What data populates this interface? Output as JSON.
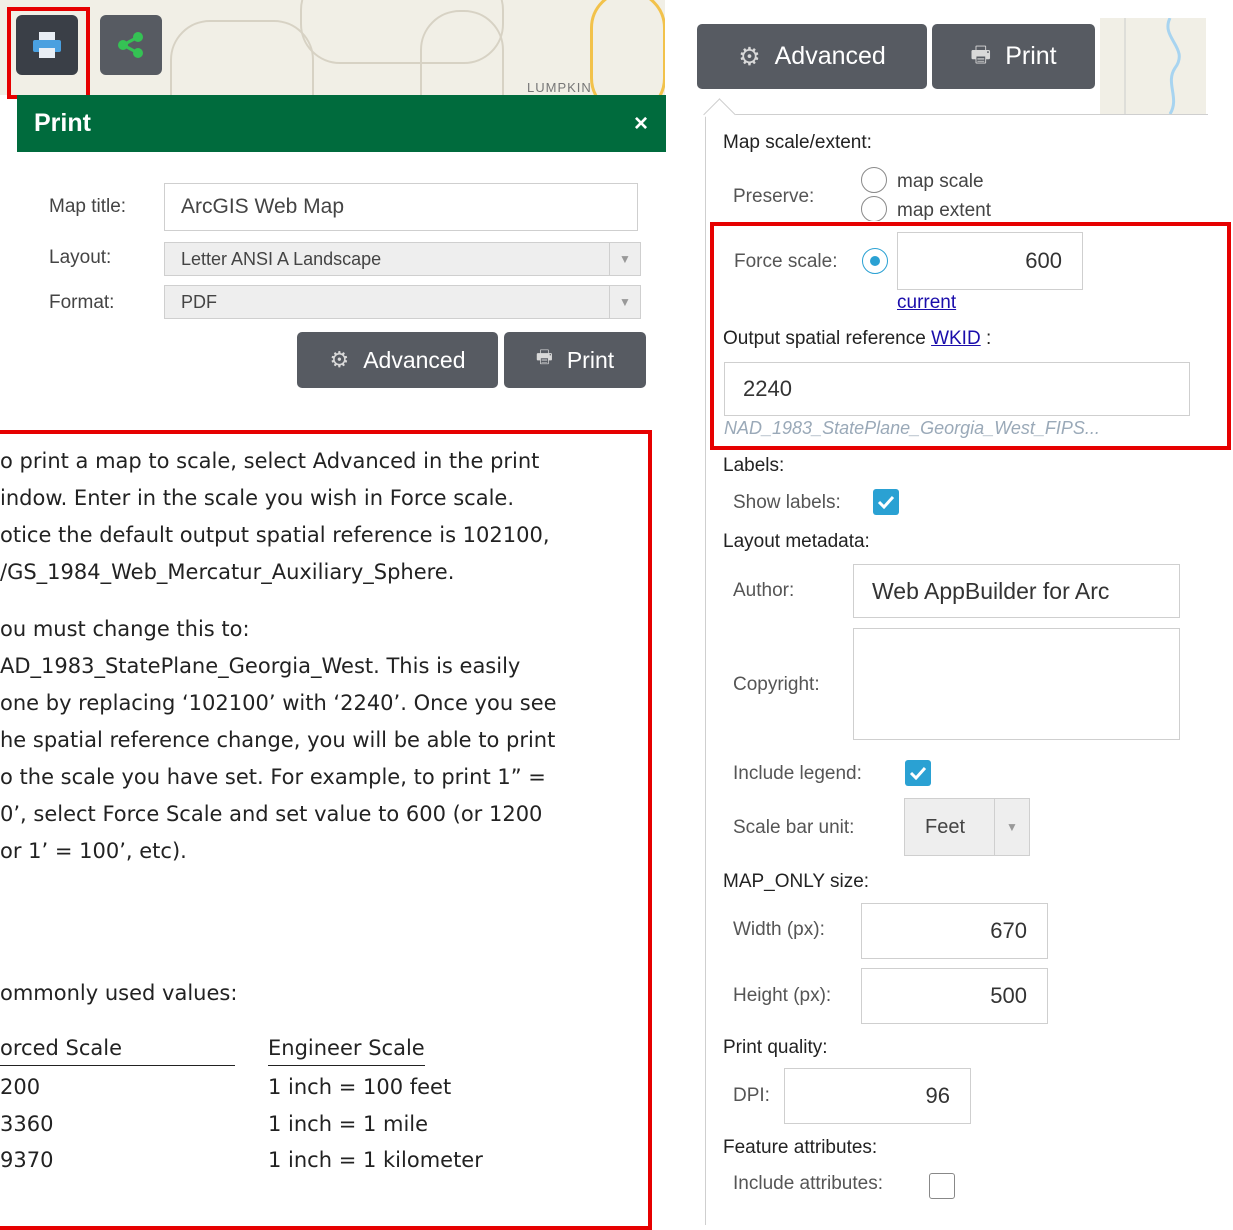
{
  "left": {
    "map_label": "LUMPKIN",
    "panel": {
      "title": "Print",
      "close": "×",
      "map_title_label": "Map title:",
      "map_title_value": "ArcGIS Web Map",
      "layout_label": "Layout:",
      "layout_value": "Letter ANSI A Landscape",
      "format_label": "Format:",
      "format_value": "PDF",
      "advanced_label": "Advanced",
      "print_label": "Print"
    },
    "note": {
      "lines": [
        "o print a map to scale, select Advanced in the print",
        "indow. Enter in the scale you wish in Force scale.",
        "otice the default output spatial reference is 102100,",
        "/GS_1984_Web_Mercatur_Auxiliary_Sphere.",
        "",
        "ou must change this to:",
        "AD_1983_StatePlane_Georgia_West. This is easily",
        "one by replacing ‘102100’ with ‘2240’. Once you see",
        "he spatial reference change, you will be able to print",
        "o the scale you have set. For example, to print 1” =",
        "0’, select Force Scale and set value to 600 (or 1200",
        "or 1’ = 100’, etc)."
      ],
      "commonly_used": "ommonly used values:",
      "col1_header": "orced Scale",
      "col2_header": "Engineer Scale",
      "rows": [
        {
          "forced": "200",
          "engineer": "1 inch = 100 feet"
        },
        {
          "forced": "3360",
          "engineer": "1 inch = 1 mile"
        },
        {
          "forced": "9370",
          "engineer": "1 inch = 1 kilometer"
        }
      ]
    }
  },
  "right": {
    "advanced_label": "Advanced",
    "print_label": "Print",
    "map_scale_extent": "Map scale/extent:",
    "preserve_label": "Preserve:",
    "opt_map_scale": "map scale",
    "opt_map_extent": "map extent",
    "force_scale_label": "Force scale:",
    "force_scale_value": "600",
    "current_link": "current",
    "osr_label": "Output spatial reference",
    "wkid_link": "WKID",
    "osr_colon": ":",
    "wkid_value": "2240",
    "wkid_name": "NAD_1983_StatePlane_Georgia_West_FIPS...",
    "labels_heading": "Labels:",
    "show_labels": "Show labels:",
    "layout_metadata": "Layout metadata:",
    "author_label": "Author:",
    "author_value": "Web AppBuilder for Arc",
    "copyright_label": "Copyright:",
    "include_legend": "Include legend:",
    "scale_bar_unit_label": "Scale bar unit:",
    "scale_bar_unit_value": "Feet",
    "map_only_size": "MAP_ONLY size:",
    "width_label": "Width (px):",
    "width_value": "670",
    "height_label": "Height (px):",
    "height_value": "500",
    "print_quality": "Print quality:",
    "dpi_label": "DPI:",
    "dpi_value": "96",
    "feature_attributes": "Feature attributes:",
    "include_attributes": "Include attributes:"
  },
  "colors": {
    "header_green": "#006b3d",
    "highlight_red": "#e60000",
    "button_gray": "#575b62",
    "check_blue": "#2aa1d3",
    "link_blue": "#1a0dab"
  }
}
